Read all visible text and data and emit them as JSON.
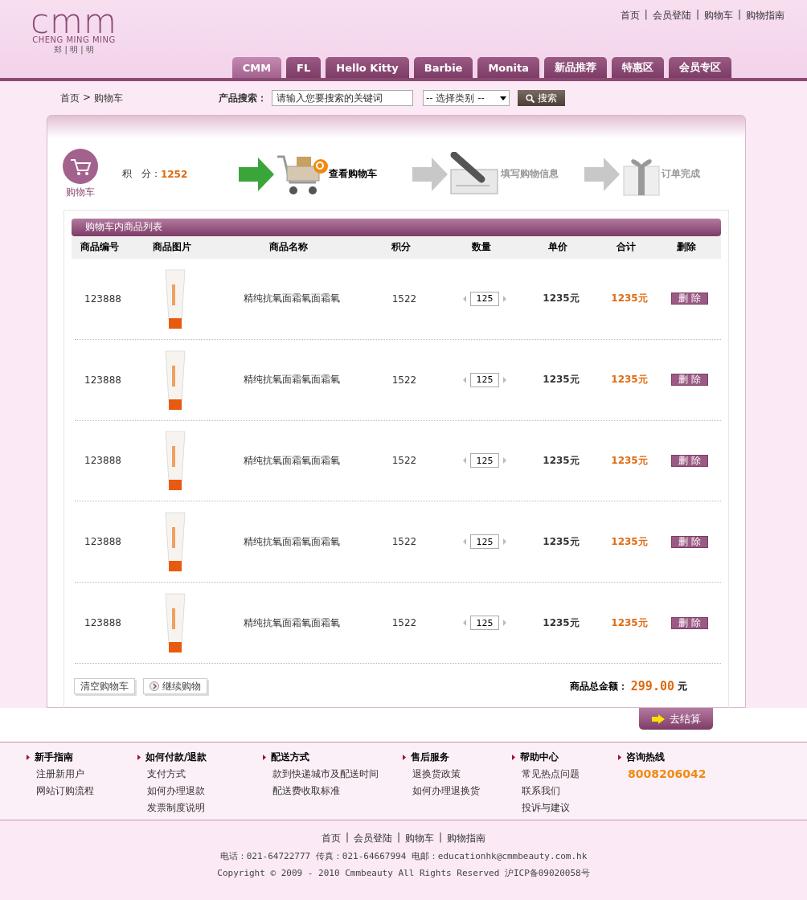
{
  "header": {
    "logo": {
      "mark": "cmm",
      "name": "CHENG MING MING",
      "sub": "郑 | 明 | 明"
    },
    "top_links": [
      "首页",
      "会员登陆",
      "购物车",
      "购物指南"
    ],
    "link_separator": "|",
    "tabs": [
      {
        "label": "CMM",
        "selected": true
      },
      {
        "label": "FL",
        "selected": false
      },
      {
        "label": "Hello Kitty",
        "selected": false
      },
      {
        "label": "Barbie",
        "selected": false
      },
      {
        "label": "Monita",
        "selected": false
      },
      {
        "label": "新品推荐",
        "selected": false
      },
      {
        "label": "特惠区",
        "selected": false
      },
      {
        "label": "会员专区",
        "selected": false
      }
    ]
  },
  "search_bar": {
    "breadcrumb": [
      "首页",
      "购物车"
    ],
    "breadcrumb_separator": ">",
    "label": "产品搜索：",
    "placeholder": "请输入您要搜索的关键词",
    "category": "-- 选择类别 --",
    "button": "搜索"
  },
  "cart": {
    "badge_label": "购物车",
    "points_label": "积　分：",
    "points": "1252",
    "steps": [
      {
        "kind": "cart",
        "label": "查看购物车",
        "selected": true
      },
      {
        "kind": "form",
        "label": "填写购物信息",
        "selected": false
      },
      {
        "kind": "gift",
        "label": "订单完成",
        "selected": false
      }
    ],
    "list_title": "购物车内商品列表",
    "columns": [
      "商品编号",
      "商品图片",
      "商品名称",
      "积分",
      "数量",
      "单价",
      "合计",
      "删除"
    ],
    "rows": [
      {
        "id": "123888",
        "name": "精纯抗氧面霜氧面霜氧",
        "points": "1522",
        "quantity": "125",
        "unit_price": "1235元",
        "total": "1235元",
        "delete": "删 除"
      },
      {
        "id": "123888",
        "name": "精纯抗氧面霜氧面霜氧",
        "points": "1522",
        "quantity": "125",
        "unit_price": "1235元",
        "total": "1235元",
        "delete": "删 除"
      },
      {
        "id": "123888",
        "name": "精纯抗氧面霜氧面霜氧",
        "points": "1522",
        "quantity": "125",
        "unit_price": "1235元",
        "total": "1235元",
        "delete": "删 除"
      },
      {
        "id": "123888",
        "name": "精纯抗氧面霜氧面霜氧",
        "points": "1522",
        "quantity": "125",
        "unit_price": "1235元",
        "total": "1235元",
        "delete": "删 除"
      },
      {
        "id": "123888",
        "name": "精纯抗氧面霜氧面霜氧",
        "points": "1522",
        "quantity": "125",
        "unit_price": "1235元",
        "total": "1235元",
        "delete": "删 除"
      }
    ],
    "clear_button": "清空购物车",
    "continue_button": "继续购物",
    "total_label": "商品总金额：",
    "total": "299.00",
    "total_unit": "元",
    "checkout_button": "去结算"
  },
  "footer": {
    "columns": [
      {
        "title": "新手指南",
        "links": [
          "注册新用户",
          "网站订购流程"
        ]
      },
      {
        "title": "如何付款/退款",
        "links": [
          "支付方式",
          "如何办理退款",
          "发票制度说明"
        ]
      },
      {
        "title": "配送方式",
        "links": [
          "款到快递城市及配送时间",
          "配送费收取标准"
        ]
      },
      {
        "title": "售后服务",
        "links": [
          "退换货政策",
          "如何办理退换货"
        ]
      },
      {
        "title": "帮助中心",
        "links": [
          "常见热点问题",
          "联系我们",
          "投诉与建议"
        ]
      },
      {
        "title": "咨询热线",
        "hotline": "8008206042"
      }
    ],
    "bottom_links": [
      "首页",
      "会员登陆",
      "购物车",
      "购物指南"
    ],
    "link_separator": "|",
    "contact": "电话：021-64722777 传真：021-64667994 电邮：educationhk@cmmbeauty.com.hk",
    "copyright": "Copyright © 2009 - 2010 Cmmbeauty All Rights Reserved 沪ICP备09020058号"
  }
}
